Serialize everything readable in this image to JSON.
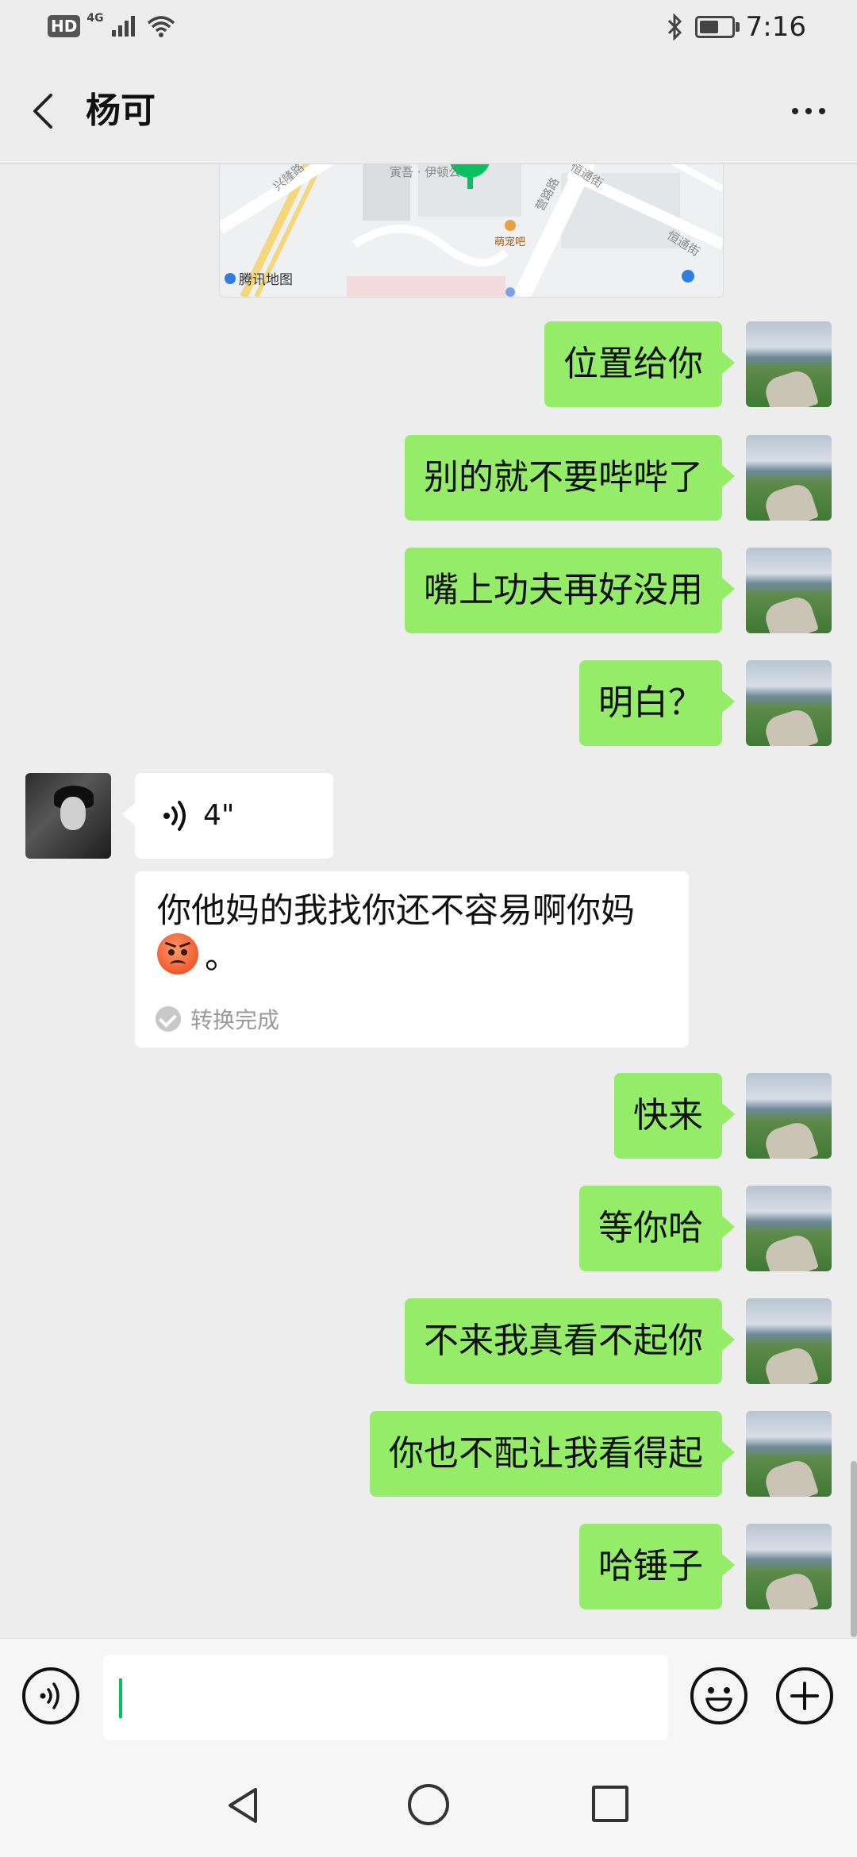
{
  "status_bar": {
    "hd_badge": "HD",
    "network": "4G",
    "time": "7:16",
    "battery_level": 0.6,
    "icons": [
      "signal-icon",
      "wifi-icon",
      "bluetooth-icon",
      "battery-icon"
    ]
  },
  "header": {
    "title": "杨可",
    "back_icon": "chevron-left-icon",
    "more_icon": "more-dots-icon"
  },
  "map": {
    "credit": "腾讯地图",
    "labels": [
      "兴隆路",
      "寅吾 · 伊顿公",
      "营路路",
      "萌宠吧",
      "恒通街",
      "恒通街"
    ]
  },
  "messages": [
    {
      "from": "self",
      "text": "位置给你"
    },
    {
      "from": "self",
      "text": "别的就不要哔哔了"
    },
    {
      "from": "self",
      "text": "嘴上功夫再好没用"
    },
    {
      "from": "self",
      "text": "明白？"
    },
    {
      "from": "other",
      "type": "voice",
      "duration": "4\""
    },
    {
      "from": "other",
      "type": "transcript",
      "text": "你他妈的我找你还不容易啊你妈",
      "suffix": "。",
      "emoji": "angry-face-emoji",
      "status": "转换完成"
    },
    {
      "from": "self",
      "text": "快来"
    },
    {
      "from": "self",
      "text": "等你哈"
    },
    {
      "from": "self",
      "text": "不来我真看不起你"
    },
    {
      "from": "self",
      "text": "你也不配让我看得起"
    },
    {
      "from": "self",
      "text": "哈锤子"
    }
  ],
  "colors": {
    "chat_bg": "#ededed",
    "bubble_out": "#95ec69",
    "bubble_in": "#ffffff",
    "caret": "#07c160"
  },
  "input_bar": {
    "voice_icon": "voice-toggle-icon",
    "emoji_icon": "emoji-icon",
    "plus_icon": "plus-icon",
    "value": ""
  },
  "nav_bar": {
    "icons": [
      "nav-back-icon",
      "nav-home-icon",
      "nav-recent-icon"
    ]
  }
}
